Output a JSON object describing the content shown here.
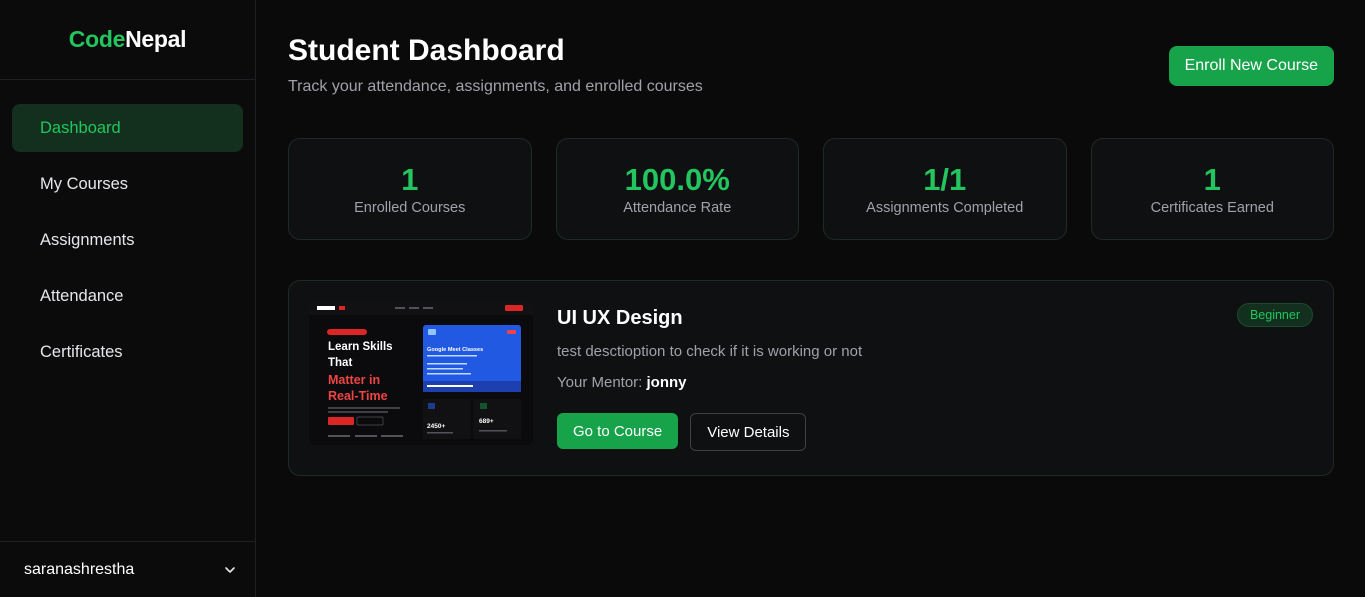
{
  "brand": {
    "code": "Code",
    "nepal": "Nepal",
    "accent": "#22c55e"
  },
  "sidebar": {
    "items": [
      {
        "label": "Dashboard",
        "active": true
      },
      {
        "label": "My Courses",
        "active": false
      },
      {
        "label": "Assignments",
        "active": false
      },
      {
        "label": "Attendance",
        "active": false
      },
      {
        "label": "Certificates",
        "active": false
      }
    ],
    "user": {
      "name": "saranashrestha",
      "icon": "chevron-down-icon"
    }
  },
  "header": {
    "title": "Student Dashboard",
    "subtitle": "Track your attendance, assignments, and enrolled courses",
    "enroll_label": "Enroll New Course"
  },
  "stats": [
    {
      "value": "1",
      "label": "Enrolled Courses"
    },
    {
      "value": "100.0%",
      "label": "Attendance Rate"
    },
    {
      "value": "1/1",
      "label": "Assignments Completed"
    },
    {
      "value": "1",
      "label": "Certificates Earned"
    }
  ],
  "course": {
    "title": "UI UX Design",
    "description": "test desctioption to check if it is working or not",
    "mentor_label": "Your Mentor:",
    "mentor_name": "jonny",
    "level": "Beginner",
    "go_label": "Go to Course",
    "details_label": "View Details",
    "thumbnail": {
      "line1": "Learn Skills",
      "line2": "That",
      "line3": "Matter in",
      "line4": "Real-Time",
      "card_title": "Google Meet Classes",
      "stat1": "2450+",
      "stat2": "689+"
    }
  }
}
